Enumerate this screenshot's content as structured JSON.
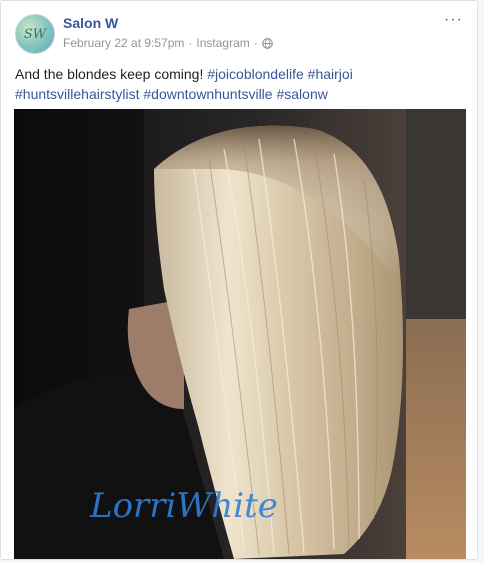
{
  "post": {
    "page_name": "Salon W",
    "avatar_text": "SW",
    "timestamp": "February 22 at 9:57pm",
    "separator": "·",
    "source": "Instagram",
    "text_plain": "And the blondes keep coming!",
    "hashtags": [
      "#joicoblondelife",
      "#hairjoi",
      "#huntsvillehairstylist",
      "#downtownhuntsville",
      "#salonw"
    ],
    "more_label": "···",
    "watermark": "LorriWhite"
  },
  "icons": {
    "privacy": "globe-icon",
    "menu": "more-options-icon"
  }
}
